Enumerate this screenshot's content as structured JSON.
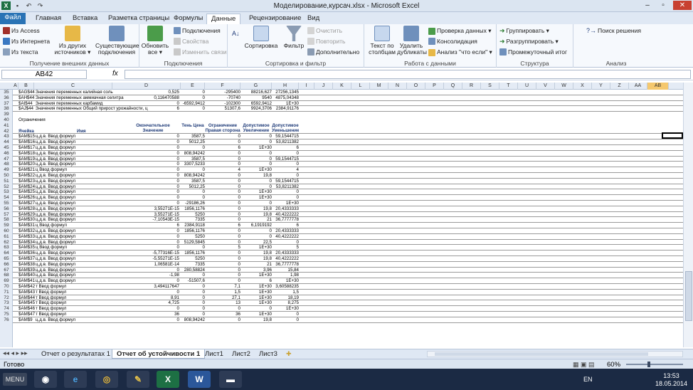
{
  "window": {
    "title": "Моделирование,курсач.xlsx  -  Microsoft Excel"
  },
  "tabs": [
    "Файл",
    "Главная",
    "Вставка",
    "Разметка страницы",
    "Формулы",
    "Данные",
    "Рецензирование",
    "Вид"
  ],
  "ribbon": {
    "g1": {
      "label": "Получение внешних данных",
      "access": "Из Access",
      "web": "Из Интернета",
      "text": "Из текста",
      "other": "Из других источников ▾",
      "existing": "Существующие подключения"
    },
    "g2": {
      "label": "Подключения",
      "refresh": "Обновить все ▾",
      "connections": "Подключения",
      "props": "Свойства",
      "edit": "Изменить связи"
    },
    "g3": {
      "label": "Сортировка и фильтр",
      "sort": "Сортировка",
      "filter": "Фильтр",
      "clear": "Очистить",
      "reapply": "Повторить",
      "advanced": "Дополнительно"
    },
    "g4": {
      "label": "Работа с данными",
      "ttc": "Текст по столбцам",
      "dups": "Удалить дубликаты",
      "valid": "Проверка данных ▾",
      "consol": "Консолидация",
      "whatif": "Анализ \"что если\" ▾"
    },
    "g5": {
      "label": "Структура",
      "group": "Группировать ▾",
      "ungroup": "Разгруппировать ▾",
      "subtotal": "Промежуточный итог"
    },
    "g6": {
      "label": "Анализ",
      "solver": "Поиск решения"
    }
  },
  "formula_bar": {
    "name_box": "AB42",
    "fx": "fx",
    "value": ""
  },
  "columns": [
    "A",
    "B",
    "C",
    "D",
    "E",
    "F",
    "G",
    "H",
    "I",
    "J",
    "K",
    "L",
    "M",
    "N",
    "O",
    "P",
    "Q",
    "R",
    "S",
    "T",
    "U",
    "V",
    "W",
    "X",
    "Y",
    "Z",
    "AA",
    "AB"
  ],
  "top_rows": [
    {
      "n": "35",
      "c1": "$AG$44",
      "c2": "Значения переменных калийная соль",
      "d": "0,525",
      "e": "0",
      "f": "-295400",
      "g": "88216,627",
      "h": "27256,1345"
    },
    {
      "n": "36",
      "c1": "$AH$44",
      "c2": "Значения переменных аммиачная селитра",
      "d": "0,116470588",
      "e": "0",
      "f": "-70740",
      "g": "9540",
      "h": "4875,04348"
    },
    {
      "n": "37",
      "c1": "$AI$44",
      "c2": "Значения переменных карбамид",
      "d": "0",
      "e": "-6592,9412",
      "f": "-102300",
      "g": "6592,9412",
      "h": "1E+30"
    },
    {
      "n": "38",
      "c1": "$AJ$44",
      "c2": "Значения переменных Общий прирост урожайности, ц",
      "d": "6",
      "e": "0",
      "f": "51307,6",
      "g": "9924,3706",
      "h": "2384,91176"
    }
  ],
  "blank_rows": [
    "39",
    "41"
  ],
  "section_label": {
    "n": "40",
    "text": "Ограничения"
  },
  "header": {
    "n": "42",
    "cell": "Ячейка",
    "name": "Имя",
    "final": "Окончательное Значение",
    "shadow": "Тень Цена",
    "rhs": "Ограничение Правая сторона",
    "inc": "Допустимое Увеличение",
    "dec": "Допустимое Уменьшение"
  },
  "rows": [
    {
      "n": "43",
      "a": "$AM$15",
      "b": "ц.д.в. Ввод формул",
      "d": "0",
      "e": "3587,5",
      "f": "0",
      "g": "0",
      "h": "59,1544715"
    },
    {
      "n": "44",
      "a": "$AM$16",
      "b": "ц.д.в. Ввод формул",
      "d": "0",
      "e": "5012,25",
      "f": "0",
      "g": "0",
      "h": "53,8211382"
    },
    {
      "n": "45",
      "a": "$AM$17",
      "b": "ц.д.в. Ввод формул",
      "d": "0",
      "e": "0",
      "f": "6",
      "g": "1E+30",
      "h": "6"
    },
    {
      "n": "46",
      "a": "$AM$18",
      "b": "ц.д.в. Ввод формул",
      "d": "0",
      "e": "808,94242",
      "f": "0",
      "g": "0",
      "h": "0"
    },
    {
      "n": "47",
      "a": "$AM$19",
      "b": "ц.д.в. Ввод формул",
      "d": "0",
      "e": "3587,5",
      "f": "0",
      "g": "0",
      "h": "59,1544715"
    },
    {
      "n": "48",
      "a": "$AM$20",
      "b": "ц.д.в. Ввод формул",
      "d": "0",
      "e": "3307,5233",
      "f": "0",
      "g": "0",
      "h": "0"
    },
    {
      "n": "49",
      "a": "$AM$21",
      "b": "ц Ввод формул",
      "d": "0",
      "e": "0",
      "f": "4",
      "g": "1E+30",
      "h": "4"
    },
    {
      "n": "50",
      "a": "$AM$22",
      "b": "ц.д.в. Ввод формул",
      "d": "0",
      "e": "808,94242",
      "f": "0",
      "g": "19,8",
      "h": "0"
    },
    {
      "n": "51",
      "a": "$AM$23",
      "b": "ц.д.в. Ввод формул",
      "d": "0",
      "e": "3587,5",
      "f": "0",
      "g": "0",
      "h": "59,1544715"
    },
    {
      "n": "52",
      "a": "$AM$24",
      "b": "ц.д.в. Ввод формул",
      "d": "0",
      "e": "5012,25",
      "f": "0",
      "g": "0",
      "h": "53,8211382"
    },
    {
      "n": "53",
      "a": "$AM$25",
      "b": "ц.д.в. Ввод формул",
      "d": "0",
      "e": "0",
      "f": "0",
      "g": "1E+30",
      "h": "0"
    },
    {
      "n": "54",
      "a": "$AM$26",
      "b": "ц.д.в. Ввод формул",
      "d": "0",
      "e": "0",
      "f": "0",
      "g": "1E+30",
      "h": "0"
    },
    {
      "n": "55",
      "a": "$AM$27",
      "b": "ц.д.в. Ввод формул",
      "d": "0",
      "e": "-29186,26",
      "f": "0",
      "g": "0",
      "h": "1E+30"
    },
    {
      "n": "56",
      "a": "$AM$28",
      "b": "ц.д.в. Ввод формул",
      "d": "3,55271E-15",
      "e": "1856,1176",
      "f": "0",
      "g": "19,8",
      "h": "20,4333333"
    },
    {
      "n": "57",
      "a": "$AM$29",
      "b": "ц.д.в. Ввод формул",
      "d": "3,55271E-15",
      "e": "5250",
      "f": "0",
      "g": "19,8",
      "h": "40,4222222"
    },
    {
      "n": "58",
      "a": "$AM$30",
      "b": "ц.д.в. Ввод формул",
      "d": "-7,10543E-15",
      "e": "7335",
      "f": "0",
      "g": "21",
      "h": "36,7777778"
    },
    {
      "n": "59",
      "a": "$AM$31",
      "b": "ц Ввод формул",
      "d": "6",
      "e": "2384,9118",
      "f": "6",
      "g": "6,1919192",
      "h": "6"
    },
    {
      "n": "60",
      "a": "$AM$32",
      "b": "ц.д.в. Ввод формул",
      "d": "0",
      "e": "1856,1176",
      "f": "0",
      "g": "0",
      "h": "20,4333333"
    },
    {
      "n": "61",
      "a": "$AM$33",
      "b": "ц.д.в. Ввод формул",
      "d": "0",
      "e": "5250",
      "f": "0",
      "g": "0",
      "h": "40,4222222"
    },
    {
      "n": "62",
      "a": "$AM$34",
      "b": "ц.д.в. Ввод формул",
      "d": "0",
      "e": "5129,5845",
      "f": "0",
      "g": "22,5",
      "h": "0"
    },
    {
      "n": "63",
      "a": "$AM$35",
      "b": "ц Ввод формул",
      "d": "0",
      "e": "0",
      "f": "5",
      "g": "1E+30",
      "h": "5"
    },
    {
      "n": "64",
      "a": "$AM$36",
      "b": "ц.д.в. Ввод формул",
      "d": "-5,77316E-15",
      "e": "1856,1176",
      "f": "0",
      "g": "19,8",
      "h": "20,4333333"
    },
    {
      "n": "65",
      "a": "$AM$37",
      "b": "ц.д.в. Ввод формул",
      "d": "-5,55271E-15",
      "e": "5250",
      "f": "0",
      "g": "19,8",
      "h": "40,4222222"
    },
    {
      "n": "66",
      "a": "$AM$38",
      "b": "ц.д.в. Ввод формул",
      "d": "1,06581E-14",
      "e": "7335",
      "f": "0",
      "g": "21",
      "h": "36,7777778"
    },
    {
      "n": "67",
      "a": "$AM$39",
      "b": "ц.д.в. Ввод формул",
      "d": "0",
      "e": "280,58824",
      "f": "0",
      "g": "3,96",
      "h": "15,84"
    },
    {
      "n": "68",
      "a": "$AM$40",
      "b": "ц.д.в. Ввод формул",
      "d": "-1,98",
      "e": "0",
      "f": "0",
      "g": "1E+30",
      "h": "1,98"
    },
    {
      "n": "69",
      "a": "$AM$41",
      "b": "ц.д.в. Ввод формул",
      "d": "0",
      "e": "-51507,6",
      "f": "0",
      "g": "6",
      "h": "1E+30"
    },
    {
      "n": "70",
      "a": "$AM$42",
      "b": "т Ввод формул",
      "d": "3,494117647",
      "e": "0",
      "f": "7,1",
      "g": "1E+30",
      "h": "3,60588235"
    },
    {
      "n": "71",
      "a": "$AM$43",
      "b": "т Ввод формул",
      "d": "0",
      "e": "0",
      "f": "1,5",
      "g": "1E+30",
      "h": "1,5"
    },
    {
      "n": "72",
      "a": "$AM$44",
      "b": "т Ввод формул",
      "d": "8,91",
      "e": "0",
      "f": "27,1",
      "g": "1E+30",
      "h": "18,19"
    },
    {
      "n": "73",
      "a": "$AM$45",
      "b": "т Ввод формул",
      "d": "4,725",
      "e": "0",
      "f": "13",
      "g": "1E+30",
      "h": "8,275"
    },
    {
      "n": "74",
      "a": "$AM$46",
      "b": "т Ввод формул",
      "d": "0",
      "e": "0",
      "f": "0",
      "g": "0",
      "h": "1E+30"
    },
    {
      "n": "75",
      "a": "$AM$47",
      "b": "т Ввод формул",
      "d": "36",
      "e": "0",
      "f": "36",
      "g": "1E+30",
      "h": "0"
    },
    {
      "n": "76",
      "a": "$AM$9",
      "b": "ц.д.в. Ввод формул",
      "d": "0",
      "e": "808,94242",
      "f": "0",
      "g": "19,8",
      "h": "0"
    }
  ],
  "sheets": {
    "s1": "Отчет о результатах 1",
    "s2": "Отчет об устойчивости 1",
    "s3": "Лист1",
    "s4": "Лист2",
    "s5": "Лист3"
  },
  "status": {
    "ready": "Готово",
    "zoom": "60%"
  },
  "taskbar": {
    "menu": "MENU",
    "lang": "EN",
    "time": "13:53",
    "date": "18.05.2014"
  }
}
